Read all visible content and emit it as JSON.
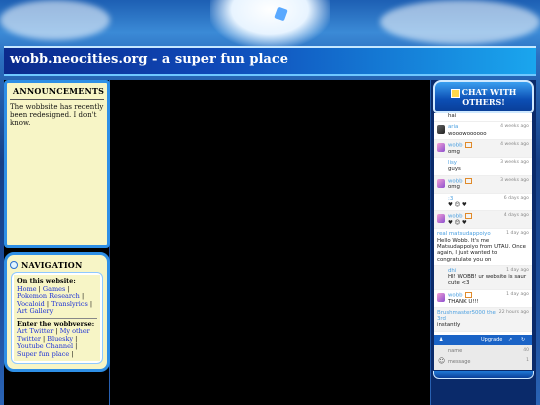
{
  "header": {
    "title": "wobb.neocities.org - a super fun place"
  },
  "announcements": {
    "heading": "ANNOUNCEMENTS",
    "text": "The wobbsite has recently been redesigned. I don't know."
  },
  "navigation": {
    "heading": "NAVIGATION",
    "on_site_label": "On this website:",
    "on_site_links": [
      "Home",
      "Games",
      "Pokemon Research",
      "Vocaloid",
      "Translyrics",
      "Art Gallery"
    ],
    "webbverse_label": "Enter the wobbverse:",
    "webbverse_links": [
      "Art Twitter",
      "My other Twitter",
      "Bluesky",
      "Youtube Channel",
      "Super fun place"
    ]
  },
  "chat": {
    "title_line1": "CHAT WITH",
    "title_line2": "OTHERS!",
    "messages": [
      {
        "user": "",
        "time": "",
        "text": "hai"
      },
      {
        "user": "aria",
        "time": "4 weeks ago",
        "text": "wooowoooooo"
      },
      {
        "user": "wobb",
        "time": "4 weeks ago",
        "text": "omg"
      },
      {
        "user": "lisy",
        "time": "3 weeks ago",
        "text": "guys"
      },
      {
        "user": "wobb",
        "time": "3 weeks ago",
        "text": "omg"
      },
      {
        "user": ":3",
        "time": "6 days ago",
        "text": "♥ 😊 ♥"
      },
      {
        "user": "wobb",
        "time": "4 days ago",
        "text": "♥ 😊 ♥"
      },
      {
        "user": "real matsudappoiyo",
        "time": "1 day ago",
        "text": "Hello Wobb. It's me Matsudappoiyo from UTAU. Once again, I just wanted to congratulate you on"
      },
      {
        "user": "dhi",
        "time": "1 day ago",
        "text": "HI! WOBB! ur website is saur cute <3"
      },
      {
        "user": "wobb",
        "time": "1 day ago",
        "text": "THANK U!!!"
      },
      {
        "user": "Brushmaster5000 the 3rd",
        "time": "22 hours ago",
        "text": "instantly"
      }
    ],
    "upgrade_label": "Upgrade",
    "name_placeholder": "name",
    "message_placeholder": "message",
    "name_count": "40",
    "message_count": "1"
  }
}
